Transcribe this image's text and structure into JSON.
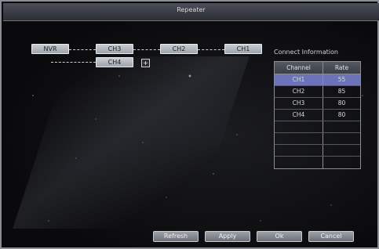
{
  "window": {
    "title": "Repeater"
  },
  "topology": {
    "nodes": [
      "NVR",
      "CH3",
      "CH2",
      "CH1",
      "CH4"
    ],
    "expand_symbol": "+"
  },
  "connect_info": {
    "title": "Connect Information",
    "headers": [
      "Channel",
      "Rate"
    ],
    "rows": [
      {
        "channel": "CH1",
        "rate": "55",
        "selected": true
      },
      {
        "channel": "CH2",
        "rate": "85",
        "selected": false
      },
      {
        "channel": "CH3",
        "rate": "80",
        "selected": false
      },
      {
        "channel": "CH4",
        "rate": "80",
        "selected": false
      }
    ],
    "empty_rows": 4
  },
  "buttons": {
    "refresh": "Refresh",
    "apply": "Apply",
    "ok": "Ok",
    "cancel": "Cancel"
  }
}
